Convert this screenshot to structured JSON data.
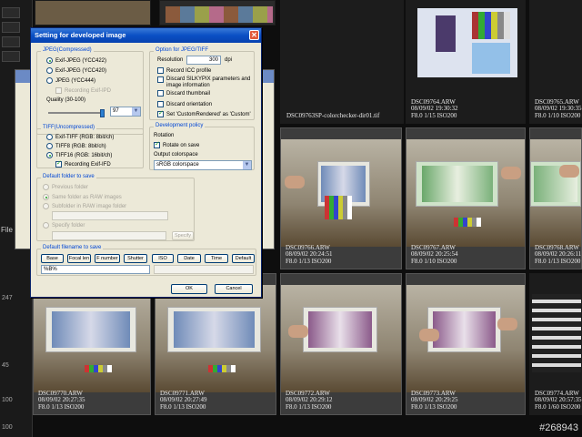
{
  "dialog": {
    "title": "Setting for developed image",
    "jpeg_group": "JPEG(Compressed)",
    "jpeg_options": [
      "Exif-JPEG  (YCC422)",
      "Exif-JPEG  (YCC420)",
      "JPEG  (YCC444)"
    ],
    "recording_exif": "Recording Exif-IPD",
    "quality_label": "Quality (30-100)",
    "quality_value": "97",
    "option_group": "Option for JPEG/TIFF",
    "resolution_label": "Resolution",
    "resolution_value": "300",
    "resolution_unit": "dpi",
    "record_icc": "Record ICC profile",
    "discard_silky": "Discard SILKYPIX parameters and image information",
    "discard_thumb": "Discard thumbnail",
    "discard_orient": "Discard orientation",
    "set_custom": "Set 'CustomRendered' as 'Custom'",
    "tiff_group": "TIFF(Uncompressed)",
    "tiff_options": [
      "Exif-TIFF  (RGB: 8bit/ch)",
      "TIFF8  (RGB: 8bit/ch)",
      "TIFF16  (RGB: 16bit/ch)"
    ],
    "recording_exif_ifd": "Recording Exif-IFD",
    "dev_group": "Development policy",
    "rotation_label": "Rotation",
    "rotate_on_save": "Rotate on save",
    "output_cs_label": "Output colorspace",
    "output_cs_value": "sRGB colorspace",
    "folder_group": "Default folder to save",
    "folder_options": [
      "Previous folder",
      "Same folder as RAW images",
      "Subfolder in RAW image folder",
      "Specify folder"
    ],
    "specify_btn": "Specify",
    "filename_group": "Default filename to save",
    "filename_buttons": [
      "Base",
      "Focal len",
      "F number",
      "Shutter",
      "ISO",
      "Date",
      "Time",
      "Default"
    ],
    "filename_value": "%B%",
    "ok": "OK",
    "cancel": "Cancel"
  },
  "thumbnails": [
    {
      "name": "DSC09763SP-colorchecker-dir01.tif",
      "line2": "",
      "line3": ""
    },
    {
      "name": "DSC09764.ARW",
      "line2": "08/09/02 19:30:32",
      "line3": "F8.0 1/15 ISO200"
    },
    {
      "name": "DSC09765.ARW",
      "line2": "08/09/02 19:30:35",
      "line3": "F8.0 1/10 ISO200"
    },
    {
      "name": "DSC09766.ARW",
      "line2": "08/09/02 20:24:51",
      "line3": "F8.0 1/13 ISO200"
    },
    {
      "name": "DSC09767.ARW",
      "line2": "08/09/02 20:25:54",
      "line3": "F8.0 1/10 ISO200"
    },
    {
      "name": "DSC09768.ARW",
      "line2": "08/09/02 20:26:11",
      "line3": "F8.0 1/13 ISO200"
    },
    {
      "name": "DSC09770.ARW",
      "line2": "08/09/02 20:27:35",
      "line3": "F8.0 1/13 ISO200"
    },
    {
      "name": "DSC09771.ARW",
      "line2": "08/09/02 20:27:49",
      "line3": "F8.0 1/13 ISO200"
    },
    {
      "name": "DSC09772.ARW",
      "line2": "08/09/02 20:29:12",
      "line3": "F8.0 1/13 ISO200"
    },
    {
      "name": "DSC09773.ARW",
      "line2": "08/09/02 20:29:25",
      "line3": "F8.0 1/13 ISO200"
    },
    {
      "name": "DSC09774.ARW",
      "line2": "08/09/02 20:57:35",
      "line3": "F8.0 1/60 ISO200"
    }
  ],
  "left_panel": {
    "value1": "247",
    "value2": "45",
    "value3": "100",
    "value4": "100",
    "caption1": "File"
  },
  "watermark": "#268943"
}
